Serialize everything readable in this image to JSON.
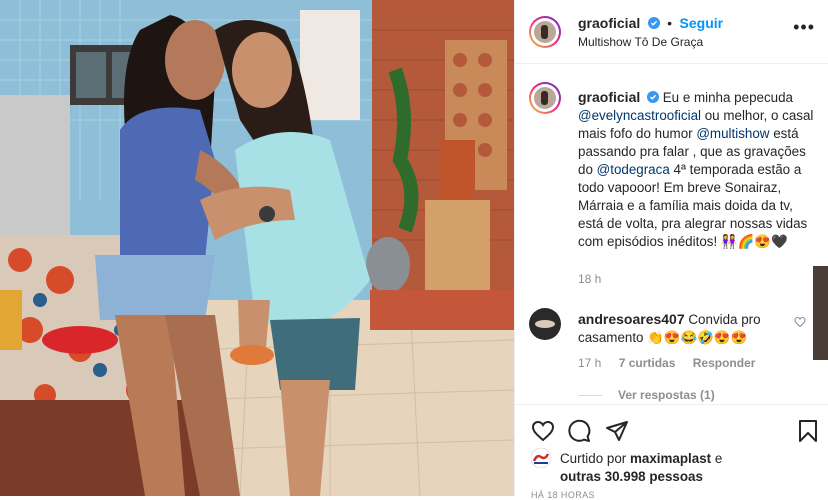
{
  "post": {
    "username": "graoficial",
    "follow_label": "Seguir",
    "location": "Multishow Tô De Graça",
    "more_icon": "more-horizontal-icon"
  },
  "caption": {
    "username": "graoficial",
    "text_1": "Eu e minha pepecuda ",
    "mention_1": "@evelyncastrooficial",
    "text_2": " ou melhor, o casal mais fofo do humor ",
    "mention_2": "@multishow",
    "text_3": " está passando pra falar , que as gravações do ",
    "mention_3": "@todegraca",
    "text_4": " 4ª temporada estão a todo vapooor! Em breve Sonairaz, Márraia e a família mais doida da tv, está de volta, pra alegrar nossas vidas com episódios inéditos! ",
    "emojis": "👭🌈😍🖤",
    "time": "18 h"
  },
  "comment": {
    "username": "andresoares407",
    "text": "Convida pro casamento ",
    "emojis": "👏😍😂🤣😍😍",
    "time": "17 h",
    "likes": "7 curtidas",
    "reply_label": "Responder",
    "view_replies": "Ver respostas (1)"
  },
  "likes": {
    "prefix": "Curtido por ",
    "user": "maximaplast",
    "middle": " e",
    "others": "outras 30.998 pessoas"
  },
  "timestamp": "HÁ 18 HORAS",
  "colors": {
    "link": "#0095f6",
    "mention": "#00376b",
    "muted": "#8e8e8e",
    "verified": "#3897f0"
  }
}
